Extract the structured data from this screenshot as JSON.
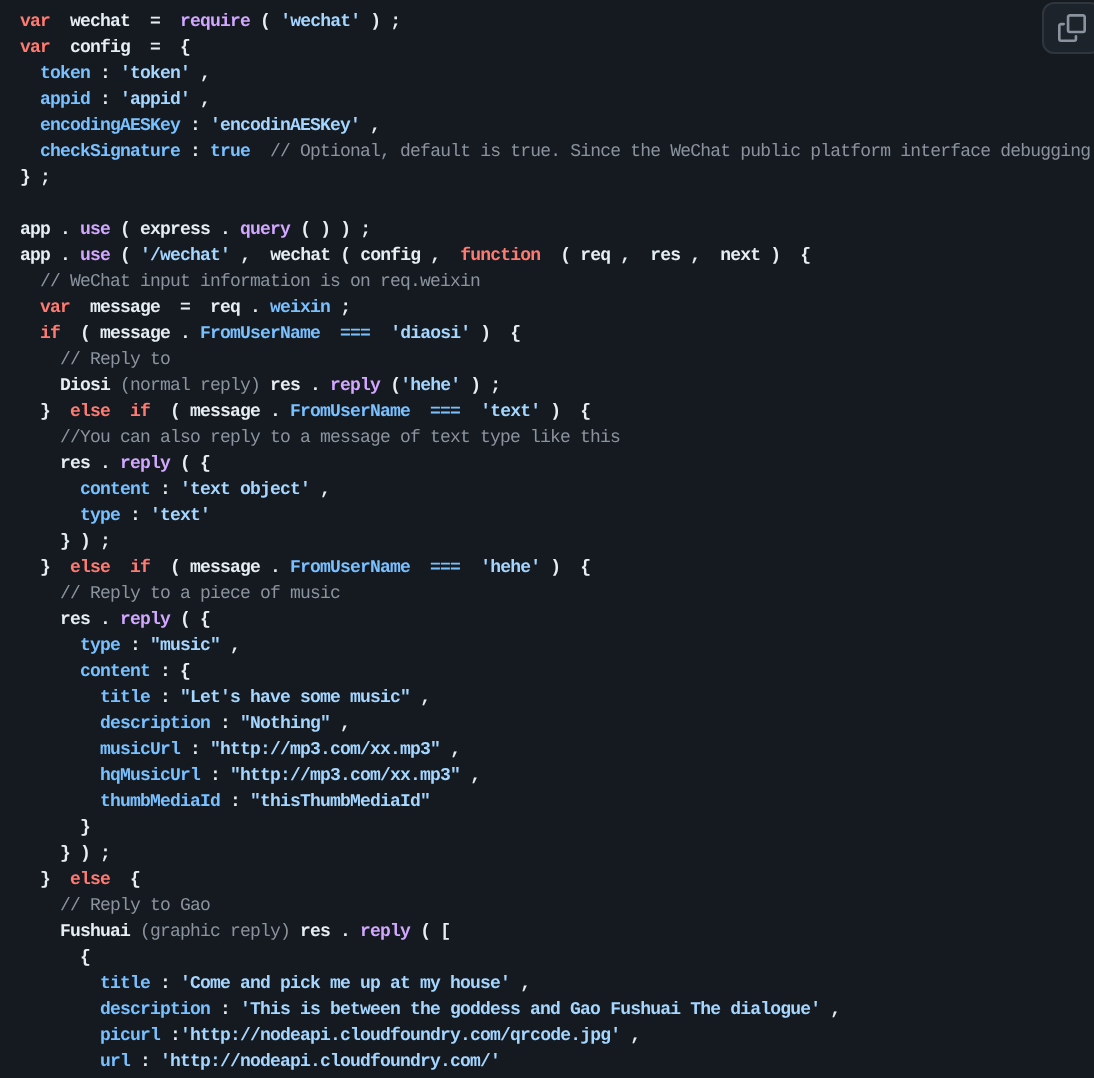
{
  "code_lines": [
    {
      "tokens": [
        {
          "text": "var",
          "kind": "keyword"
        },
        {
          "text": "  wechat  =  ",
          "kind": "plain"
        },
        {
          "text": "require",
          "kind": "function"
        },
        {
          "text": " ( ",
          "kind": "plain"
        },
        {
          "text": "'wechat'",
          "kind": "string"
        },
        {
          "text": " ) ;",
          "kind": "plain"
        }
      ]
    },
    {
      "tokens": [
        {
          "text": "var",
          "kind": "keyword"
        },
        {
          "text": "  config  =  {",
          "kind": "plain"
        }
      ],
      "children": [
        {
          "tokens": [
            {
              "text": "token",
              "kind": "property"
            },
            {
              "text": " : ",
              "kind": "plain"
            },
            {
              "text": "'token'",
              "kind": "string"
            },
            {
              "text": " ,",
              "kind": "plain"
            }
          ]
        },
        {
          "tokens": [
            {
              "text": "appid",
              "kind": "property"
            },
            {
              "text": " : ",
              "kind": "plain"
            },
            {
              "text": "'appid'",
              "kind": "string"
            },
            {
              "text": " ,",
              "kind": "plain"
            }
          ]
        },
        {
          "tokens": [
            {
              "text": "encodingAESKey",
              "kind": "property"
            },
            {
              "text": " : ",
              "kind": "plain"
            },
            {
              "text": "'encodinAESKey'",
              "kind": "string"
            },
            {
              "text": " ,",
              "kind": "plain"
            }
          ]
        },
        {
          "tokens": [
            {
              "text": "checkSignature",
              "kind": "property"
            },
            {
              "text": " : ",
              "kind": "plain"
            },
            {
              "text": "true",
              "kind": "property"
            },
            {
              "text": "  // Optional, default is true. Since the WeChat public platform interface debugging",
              "kind": "comment"
            }
          ]
        }
      ]
    },
    {
      "tokens": [
        {
          "text": "} ;",
          "kind": "plain"
        }
      ]
    },
    {
      "gap_before": true,
      "tokens": [
        {
          "text": "app . ",
          "kind": "plain"
        },
        {
          "text": "use",
          "kind": "function"
        },
        {
          "text": " ( express . ",
          "kind": "plain"
        },
        {
          "text": "query",
          "kind": "function"
        },
        {
          "text": " ( ) ) ;",
          "kind": "plain"
        }
      ]
    },
    {
      "tokens": [
        {
          "text": "app . ",
          "kind": "plain"
        },
        {
          "text": "use",
          "kind": "function"
        },
        {
          "text": " ( ",
          "kind": "plain"
        },
        {
          "text": "'/wechat'",
          "kind": "string"
        },
        {
          "text": " ,  wechat ( config ,  ",
          "kind": "plain"
        },
        {
          "text": "function",
          "kind": "keyword"
        },
        {
          "text": "  ( req ,  res ,  next )  {",
          "kind": "plain"
        }
      ],
      "children": [
        {
          "tokens": [
            {
              "text": "// WeChat input information is on req.weixin",
              "kind": "comment"
            }
          ]
        },
        {
          "tokens": [
            {
              "text": "var",
              "kind": "keyword"
            },
            {
              "text": "  message  =  req . ",
              "kind": "plain"
            },
            {
              "text": "weixin",
              "kind": "property"
            },
            {
              "text": " ;",
              "kind": "plain"
            }
          ]
        },
        {
          "tokens": [
            {
              "text": "if",
              "kind": "keyword"
            },
            {
              "text": "  ( message . ",
              "kind": "plain"
            },
            {
              "text": "FromUserName  ===  ",
              "kind": "property"
            },
            {
              "text": "'diaosi'",
              "kind": "string"
            },
            {
              "text": " )  {",
              "kind": "plain"
            }
          ],
          "children": [
            {
              "tokens": [
                {
                  "text": "// Reply to",
                  "kind": "comment"
                }
              ]
            },
            {
              "tokens": [
                {
                  "text": "Diosi ",
                  "kind": "plain"
                },
                {
                  "text": "(normal reply)",
                  "kind": "comment"
                },
                {
                  "text": " res . ",
                  "kind": "plain"
                },
                {
                  "text": "reply",
                  "kind": "function"
                },
                {
                  "text": " (",
                  "kind": "plain"
                },
                {
                  "text": "'hehe'",
                  "kind": "string"
                },
                {
                  "text": " ) ;",
                  "kind": "plain"
                }
              ]
            }
          ]
        },
        {
          "tokens": [
            {
              "text": "}  ",
              "kind": "plain"
            },
            {
              "text": "else  if",
              "kind": "keyword"
            },
            {
              "text": "  ( message . ",
              "kind": "plain"
            },
            {
              "text": "FromUserName  ===  ",
              "kind": "property"
            },
            {
              "text": "'text'",
              "kind": "string"
            },
            {
              "text": " )  {",
              "kind": "plain"
            }
          ],
          "children": [
            {
              "tokens": [
                {
                  "text": "//You can also reply to a message of text type like this",
                  "kind": "comment"
                }
              ]
            },
            {
              "tokens": [
                {
                  "text": "res . ",
                  "kind": "plain"
                },
                {
                  "text": "reply",
                  "kind": "function"
                },
                {
                  "text": " ( {",
                  "kind": "plain"
                }
              ],
              "children": [
                {
                  "tokens": [
                    {
                      "text": "content",
                      "kind": "property"
                    },
                    {
                      "text": " : ",
                      "kind": "plain"
                    },
                    {
                      "text": "'text object'",
                      "kind": "string"
                    },
                    {
                      "text": " ,",
                      "kind": "plain"
                    }
                  ]
                },
                {
                  "tokens": [
                    {
                      "text": "type",
                      "kind": "property"
                    },
                    {
                      "text": " : ",
                      "kind": "plain"
                    },
                    {
                      "text": "'text'",
                      "kind": "string"
                    }
                  ]
                }
              ]
            },
            {
              "tokens": [
                {
                  "text": "} ) ;",
                  "kind": "plain"
                }
              ]
            }
          ]
        },
        {
          "tokens": [
            {
              "text": "}  ",
              "kind": "plain"
            },
            {
              "text": "else  if",
              "kind": "keyword"
            },
            {
              "text": "  ( message . ",
              "kind": "plain"
            },
            {
              "text": "FromUserName  ===  ",
              "kind": "property"
            },
            {
              "text": "'hehe'",
              "kind": "string"
            },
            {
              "text": " )  {",
              "kind": "plain"
            }
          ],
          "children": [
            {
              "tokens": [
                {
                  "text": "// Reply to a piece of music",
                  "kind": "comment"
                }
              ]
            },
            {
              "tokens": [
                {
                  "text": "res . ",
                  "kind": "plain"
                },
                {
                  "text": "reply",
                  "kind": "function"
                },
                {
                  "text": " ( {",
                  "kind": "plain"
                }
              ],
              "children": [
                {
                  "tokens": [
                    {
                      "text": "type",
                      "kind": "property"
                    },
                    {
                      "text": " : ",
                      "kind": "plain"
                    },
                    {
                      "text": "\"music\"",
                      "kind": "string"
                    },
                    {
                      "text": " ,",
                      "kind": "plain"
                    }
                  ]
                },
                {
                  "tokens": [
                    {
                      "text": "content",
                      "kind": "property"
                    },
                    {
                      "text": " : {",
                      "kind": "plain"
                    }
                  ],
                  "children": [
                    {
                      "tokens": [
                        {
                          "text": "title",
                          "kind": "property"
                        },
                        {
                          "text": " : ",
                          "kind": "plain"
                        },
                        {
                          "text": "\"Let's have some music\"",
                          "kind": "string"
                        },
                        {
                          "text": " ,",
                          "kind": "plain"
                        }
                      ]
                    },
                    {
                      "tokens": [
                        {
                          "text": "description",
                          "kind": "property"
                        },
                        {
                          "text": " : ",
                          "kind": "plain"
                        },
                        {
                          "text": "\"Nothing\"",
                          "kind": "string"
                        },
                        {
                          "text": " ,",
                          "kind": "plain"
                        }
                      ]
                    },
                    {
                      "tokens": [
                        {
                          "text": "musicUrl",
                          "kind": "property"
                        },
                        {
                          "text": " : ",
                          "kind": "plain"
                        },
                        {
                          "text": "\"http://mp3.com/xx.mp3\"",
                          "kind": "string"
                        },
                        {
                          "text": " ,",
                          "kind": "plain"
                        }
                      ]
                    },
                    {
                      "tokens": [
                        {
                          "text": "hqMusicUrl",
                          "kind": "property"
                        },
                        {
                          "text": " : ",
                          "kind": "plain"
                        },
                        {
                          "text": "\"http://mp3.com/xx.mp3\"",
                          "kind": "string"
                        },
                        {
                          "text": " ,",
                          "kind": "plain"
                        }
                      ]
                    },
                    {
                      "tokens": [
                        {
                          "text": "thumbMediaId",
                          "kind": "property"
                        },
                        {
                          "text": " : ",
                          "kind": "plain"
                        },
                        {
                          "text": "\"thisThumbMediaId\"",
                          "kind": "string"
                        }
                      ]
                    }
                  ]
                },
                {
                  "tokens": [
                    {
                      "text": "}",
                      "kind": "plain"
                    }
                  ]
                }
              ]
            },
            {
              "tokens": [
                {
                  "text": "} ) ;",
                  "kind": "plain"
                }
              ]
            }
          ]
        },
        {
          "tokens": [
            {
              "text": "}  ",
              "kind": "plain"
            },
            {
              "text": "else",
              "kind": "keyword"
            },
            {
              "text": "  {",
              "kind": "plain"
            }
          ],
          "children": [
            {
              "tokens": [
                {
                  "text": "// Reply to Gao",
                  "kind": "comment"
                }
              ]
            },
            {
              "tokens": [
                {
                  "text": "Fushuai ",
                  "kind": "plain"
                },
                {
                  "text": "(graphic reply)",
                  "kind": "comment"
                },
                {
                  "text": " res . ",
                  "kind": "plain"
                },
                {
                  "text": "reply",
                  "kind": "function"
                },
                {
                  "text": " ( [",
                  "kind": "plain"
                }
              ],
              "children": [
                {
                  "tokens": [
                    {
                      "text": "{",
                      "kind": "plain"
                    }
                  ],
                  "children": [
                    {
                      "tokens": [
                        {
                          "text": "title",
                          "kind": "property"
                        },
                        {
                          "text": " : ",
                          "kind": "plain"
                        },
                        {
                          "text": "'Come and pick me up at my house'",
                          "kind": "string"
                        },
                        {
                          "text": " ,",
                          "kind": "plain"
                        }
                      ]
                    },
                    {
                      "tokens": [
                        {
                          "text": "description",
                          "kind": "property"
                        },
                        {
                          "text": " : ",
                          "kind": "plain"
                        },
                        {
                          "text": "'This is between the goddess and Gao Fushuai The dialogue'",
                          "kind": "string"
                        },
                        {
                          "text": " ,",
                          "kind": "plain"
                        }
                      ]
                    },
                    {
                      "tokens": [
                        {
                          "text": "picurl",
                          "kind": "property"
                        },
                        {
                          "text": " :",
                          "kind": "plain"
                        },
                        {
                          "text": "'http://nodeapi.cloudfoundry.com/qrcode.jpg'",
                          "kind": "string"
                        },
                        {
                          "text": " ,",
                          "kind": "plain"
                        }
                      ]
                    },
                    {
                      "tokens": [
                        {
                          "text": "url",
                          "kind": "property"
                        },
                        {
                          "text": " : ",
                          "kind": "plain"
                        },
                        {
                          "text": "'http://nodeapi.cloudfoundry.com/'",
                          "kind": "string"
                        }
                      ]
                    }
                  ]
                }
              ]
            }
          ]
        }
      ]
    }
  ]
}
